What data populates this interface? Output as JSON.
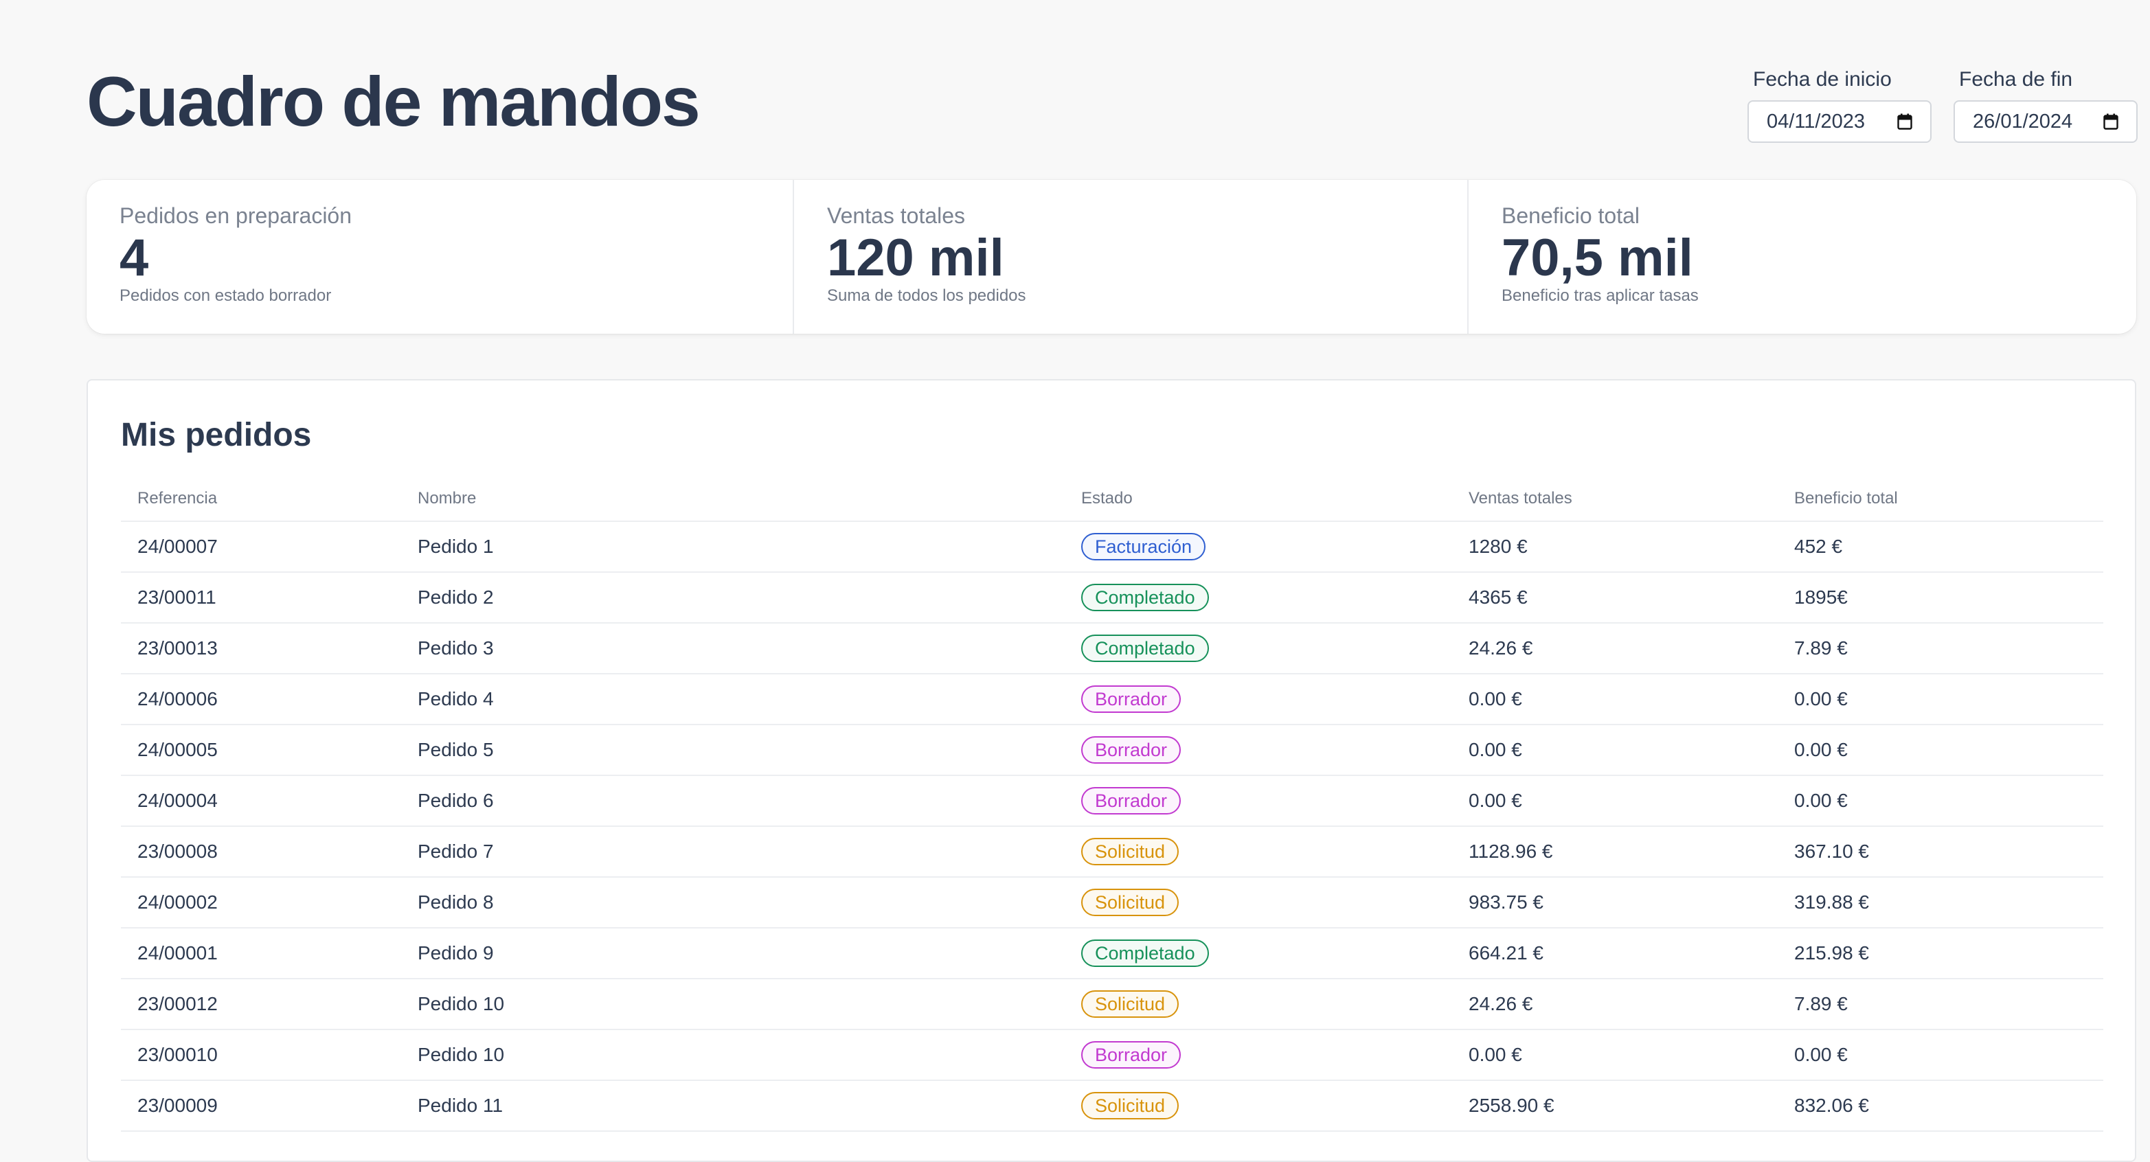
{
  "header": {
    "title": "Cuadro de mandos",
    "start_date": {
      "label": "Fecha de inicio",
      "value": "04/11/2023"
    },
    "end_date": {
      "label": "Fecha de fin",
      "value": "26/01/2024"
    }
  },
  "stats": [
    {
      "label": "Pedidos en preparación",
      "value": "4",
      "description": "Pedidos con estado borrador"
    },
    {
      "label": "Ventas totales",
      "value": "120 mil",
      "description": "Suma de todos los pedidos"
    },
    {
      "label": "Beneficio total",
      "value": "70,5 mil",
      "description": "Beneficio tras aplicar tasas"
    }
  ],
  "orders": {
    "title": "Mis pedidos",
    "columns": [
      "Referencia",
      "Nombre",
      "Estado",
      "Ventas totales",
      "Beneficio total"
    ],
    "rows": [
      {
        "ref": "24/00007",
        "name": "Pedido 1",
        "status": "Facturación",
        "status_color": "blue",
        "sales": "1280 €",
        "profit": "452 €"
      },
      {
        "ref": "23/00011",
        "name": "Pedido 2",
        "status": "Completado",
        "status_color": "green",
        "sales": "4365 €",
        "profit": "1895€"
      },
      {
        "ref": "23/00013",
        "name": "Pedido 3",
        "status": "Completado",
        "status_color": "green",
        "sales": "24.26 €",
        "profit": "7.89 €"
      },
      {
        "ref": "24/00006",
        "name": "Pedido 4",
        "status": "Borrador",
        "status_color": "purple",
        "sales": "0.00 €",
        "profit": "0.00 €"
      },
      {
        "ref": "24/00005",
        "name": "Pedido 5",
        "status": "Borrador",
        "status_color": "purple",
        "sales": "0.00 €",
        "profit": "0.00 €"
      },
      {
        "ref": "24/00004",
        "name": "Pedido 6",
        "status": "Borrador",
        "status_color": "purple",
        "sales": "0.00 €",
        "profit": "0.00 €"
      },
      {
        "ref": "23/00008",
        "name": "Pedido 7",
        "status": "Solicitud",
        "status_color": "orange",
        "sales": "1128.96 €",
        "profit": "367.10 €"
      },
      {
        "ref": "24/00002",
        "name": "Pedido 8",
        "status": "Solicitud",
        "status_color": "orange",
        "sales": "983.75 €",
        "profit": "319.88 €"
      },
      {
        "ref": "24/00001",
        "name": "Pedido 9",
        "status": "Completado",
        "status_color": "green",
        "sales": "664.21 €",
        "profit": "215.98 €"
      },
      {
        "ref": "23/00012",
        "name": "Pedido 10",
        "status": "Solicitud",
        "status_color": "orange",
        "sales": "24.26 €",
        "profit": "7.89 €"
      },
      {
        "ref": "23/00010",
        "name": "Pedido 10",
        "status": "Borrador",
        "status_color": "purple",
        "sales": "0.00 €",
        "profit": "0.00 €"
      },
      {
        "ref": "23/00009",
        "name": "Pedido 11",
        "status": "Solicitud",
        "status_color": "orange",
        "sales": "2558.90 €",
        "profit": "832.06 €"
      }
    ]
  },
  "icons": {
    "date_picker": "calendar-icon"
  }
}
